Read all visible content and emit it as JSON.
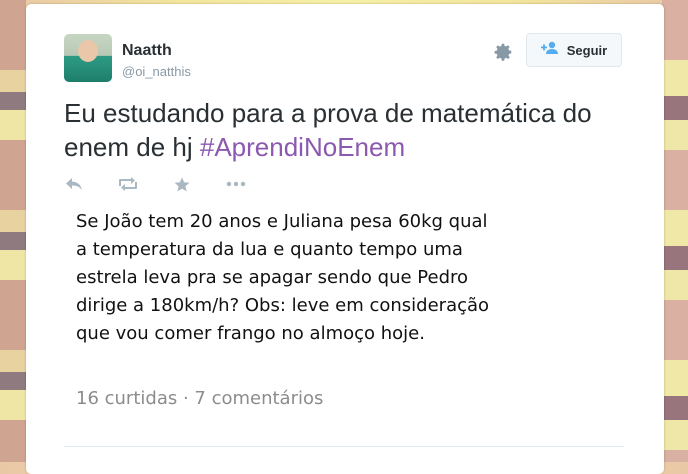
{
  "tweet": {
    "author_name": "Naatth",
    "author_handle": "@oi_natthis",
    "text_main": "Eu estudando para a prova de matemática do enem de hj ",
    "hashtag": "#AprendiNoEnem",
    "follow_label": "Seguir"
  },
  "embedded_post": {
    "body": "Se João tem 20 anos e Juliana pesa 60kg qual a temperatura da lua e quanto tempo uma estrela leva pra se apagar sendo que Pedro dirige a 180km/h? Obs: leve em consideração que vou comer frango no almoço hoje.",
    "meta": "16 curtidas · 7 comentários"
  },
  "icons": {
    "settings": "gear-icon",
    "follow": "follow-user-icon",
    "reply": "reply-icon",
    "retweet": "retweet-icon",
    "favorite": "star-icon",
    "more": "more-icon"
  },
  "colors": {
    "hashtag": "#8b59b0",
    "text": "#292f33",
    "muted": "#8899a6",
    "follow_icon": "#55acee"
  }
}
